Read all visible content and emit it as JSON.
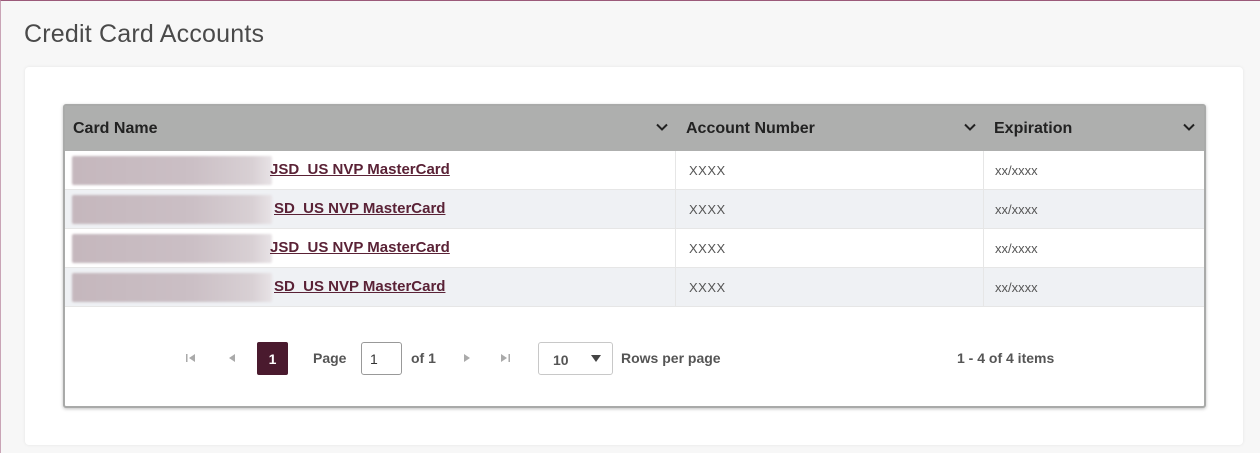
{
  "page": {
    "title": "Credit Card Accounts"
  },
  "grid": {
    "columns": [
      {
        "label": "Card Name",
        "icon": "chevron-down-icon"
      },
      {
        "label": "Account Number",
        "icon": "chevron-down-icon"
      },
      {
        "label": "Expiration",
        "icon": "chevron-down-icon"
      }
    ],
    "rows": [
      {
        "card_name": "JSD_US NVP MasterCard",
        "account_number": "XXXX",
        "expiration": "xx/xxxx"
      },
      {
        "card_name": "SD_US NVP MasterCard",
        "account_number": "XXXX",
        "expiration": "xx/xxxx"
      },
      {
        "card_name": "JSD_US NVP MasterCard",
        "account_number": "XXXX",
        "expiration": "xx/xxxx"
      },
      {
        "card_name": "SD_US NVP MasterCard",
        "account_number": "XXXX",
        "expiration": "xx/xxxx"
      }
    ]
  },
  "pager": {
    "current_page": "1",
    "page_label": "Page",
    "page_input_value": "1",
    "of_label": "of 1",
    "rows_per_page_value": "10",
    "rows_per_page_label": "Rows per page",
    "info": "1 - 4 of 4 items"
  },
  "colors": {
    "accent": "#4a1a2e",
    "link": "#5a2236",
    "header_bg": "#aeafae",
    "alt_row_bg": "#eff1f4"
  }
}
